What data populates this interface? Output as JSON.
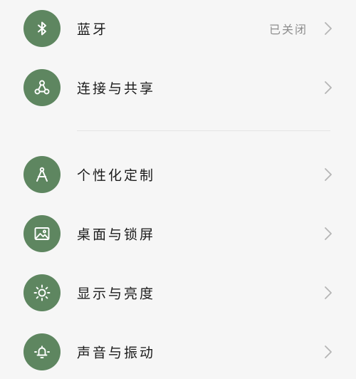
{
  "settings": {
    "group1": [
      {
        "id": "bluetooth",
        "label": "蓝牙",
        "value": "已关闭",
        "icon": "bluetooth-icon"
      },
      {
        "id": "connection-sharing",
        "label": "连接与共享",
        "icon": "share-nodes-icon"
      }
    ],
    "group2": [
      {
        "id": "personalization",
        "label": "个性化定制",
        "icon": "compass-drawing-icon"
      },
      {
        "id": "wallpaper-lockscreen",
        "label": "桌面与锁屏",
        "icon": "picture-icon"
      },
      {
        "id": "display-brightness",
        "label": "显示与亮度",
        "icon": "sun-icon"
      },
      {
        "id": "sound-vibration",
        "label": "声音与振动",
        "icon": "bell-icon"
      }
    ]
  },
  "colors": {
    "icon_background": "#5e8660",
    "background": "#f6f6f6",
    "label_text": "#1b1b1b",
    "value_text": "#8d8d8d",
    "chevron": "#b5b5b5"
  }
}
